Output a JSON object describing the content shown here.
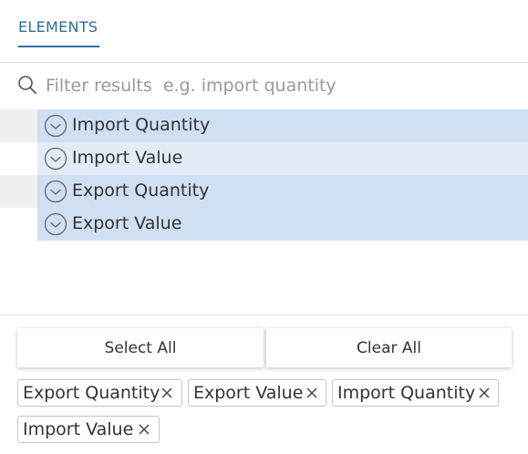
{
  "tabs": [
    {
      "label": "ELEMENTS",
      "active": true
    }
  ],
  "filter": {
    "placeholder": "Filter results  e.g. import quantity",
    "value": ""
  },
  "results": [
    {
      "label": "Import Quantity",
      "selected": true
    },
    {
      "label": "Import Value",
      "selected": true
    },
    {
      "label": "Export Quantity",
      "selected": true
    },
    {
      "label": "Export Value",
      "selected": true
    }
  ],
  "buttons": {
    "select_all": "Select All",
    "clear_all": "Clear All"
  },
  "chips": [
    {
      "label": "Export Quantity"
    },
    {
      "label": "Export Value"
    },
    {
      "label": "Import Quantity"
    },
    {
      "label": "Import Value"
    }
  ],
  "icons": {
    "search": "search-icon",
    "check": "check-circle-icon",
    "remove": "close-icon"
  },
  "colors": {
    "accent": "#2f6f9f",
    "row_odd": "#cfe0f2",
    "row_even": "#e1ecf7"
  }
}
